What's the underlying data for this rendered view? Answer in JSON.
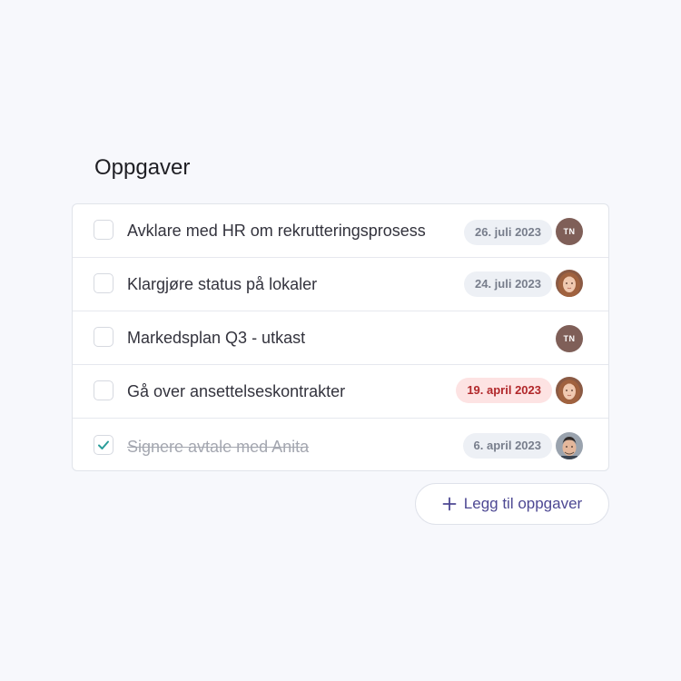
{
  "page": {
    "title": "Oppgaver"
  },
  "tasks": [
    {
      "label": "Avklare med HR om rekrutteringsprosess",
      "date": "26. juli 2023",
      "date_status": "neutral",
      "assignee_initials": "TN",
      "assignee_avatar": "initials-avatar",
      "checked": false
    },
    {
      "label": "Klargjøre status på lokaler",
      "date": "24. juli 2023",
      "date_status": "neutral",
      "assignee_initials": "",
      "assignee_avatar": "woman-photo-avatar",
      "checked": false
    },
    {
      "label": "Markedsplan Q3 - utkast",
      "date": "",
      "date_status": "none",
      "assignee_initials": "TN",
      "assignee_avatar": "initials-avatar",
      "checked": false
    },
    {
      "label": "Gå over ansettelseskontrakter",
      "date": "19. april 2023",
      "date_status": "overdue",
      "assignee_initials": "",
      "assignee_avatar": "woman-photo-avatar",
      "checked": false
    },
    {
      "label": "Signere avtale med Anita",
      "date": "6. april 2023",
      "date_status": "neutral",
      "assignee_initials": "",
      "assignee_avatar": "man-photo-avatar",
      "checked": true
    }
  ],
  "actions": {
    "add_tasks_label": "Legg til oppgaver",
    "add_icon": "plus-icon"
  },
  "colors": {
    "accent": "#4d4893",
    "check": "#2a9d9a",
    "overdue_bg": "#fde3e3",
    "overdue_text": "#b1272a",
    "neutral_badge_bg": "#edf0f5",
    "initials_avatar_bg": "#7f5f58"
  }
}
